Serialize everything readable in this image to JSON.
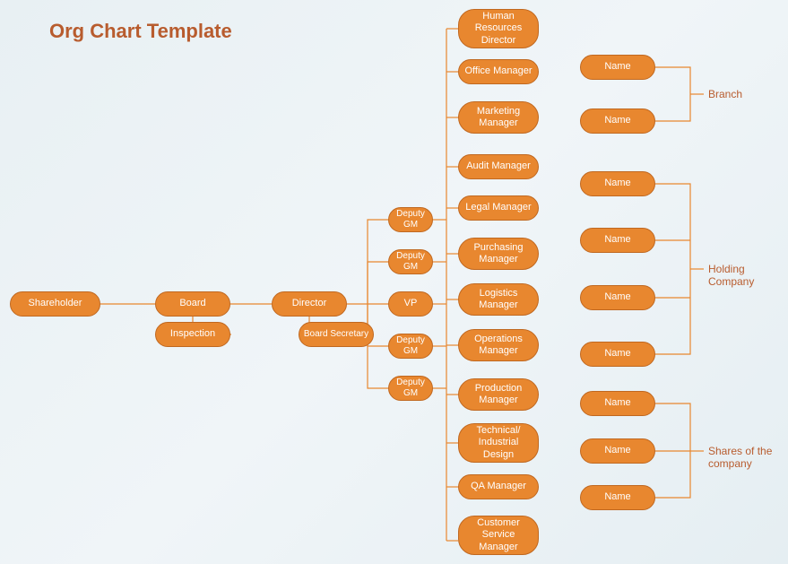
{
  "title": "Org Chart Template",
  "nodes": {
    "shareholder": "Shareholder",
    "board": "Board",
    "inspection": "Inspection",
    "director": "Director",
    "board_secretary": "Board Secretary",
    "deputy_gm_1": "Deputy GM",
    "deputy_gm_2": "Deputy GM",
    "vp": "VP",
    "deputy_gm_3": "Deputy GM",
    "deputy_gm_4": "Deputy GM",
    "hr_director": "Human Resources Director",
    "office_manager": "Office Manager",
    "marketing_manager": "Marketing Manager",
    "audit_manager": "Audit Manager",
    "legal_manager": "Legal Manager",
    "purchasing_manager": "Purchasing Manager",
    "logistics_manager": "Logistics Manager",
    "operations_manager": "Operations Manager",
    "production_manager": "Production Manager",
    "technical_design": "Technical/ Industrial Design",
    "qa_manager": "QA Manager",
    "customer_service_manager": "Customer Service Manager",
    "branch_name_1": "Name",
    "branch_name_2": "Name",
    "holding_name_1": "Name",
    "holding_name_2": "Name",
    "holding_name_3": "Name",
    "holding_name_4": "Name",
    "shares_name_1": "Name",
    "shares_name_2": "Name",
    "shares_name_3": "Name"
  },
  "labels": {
    "branch": "Branch",
    "holding": "Holding Company",
    "shares": "Shares of the company"
  }
}
